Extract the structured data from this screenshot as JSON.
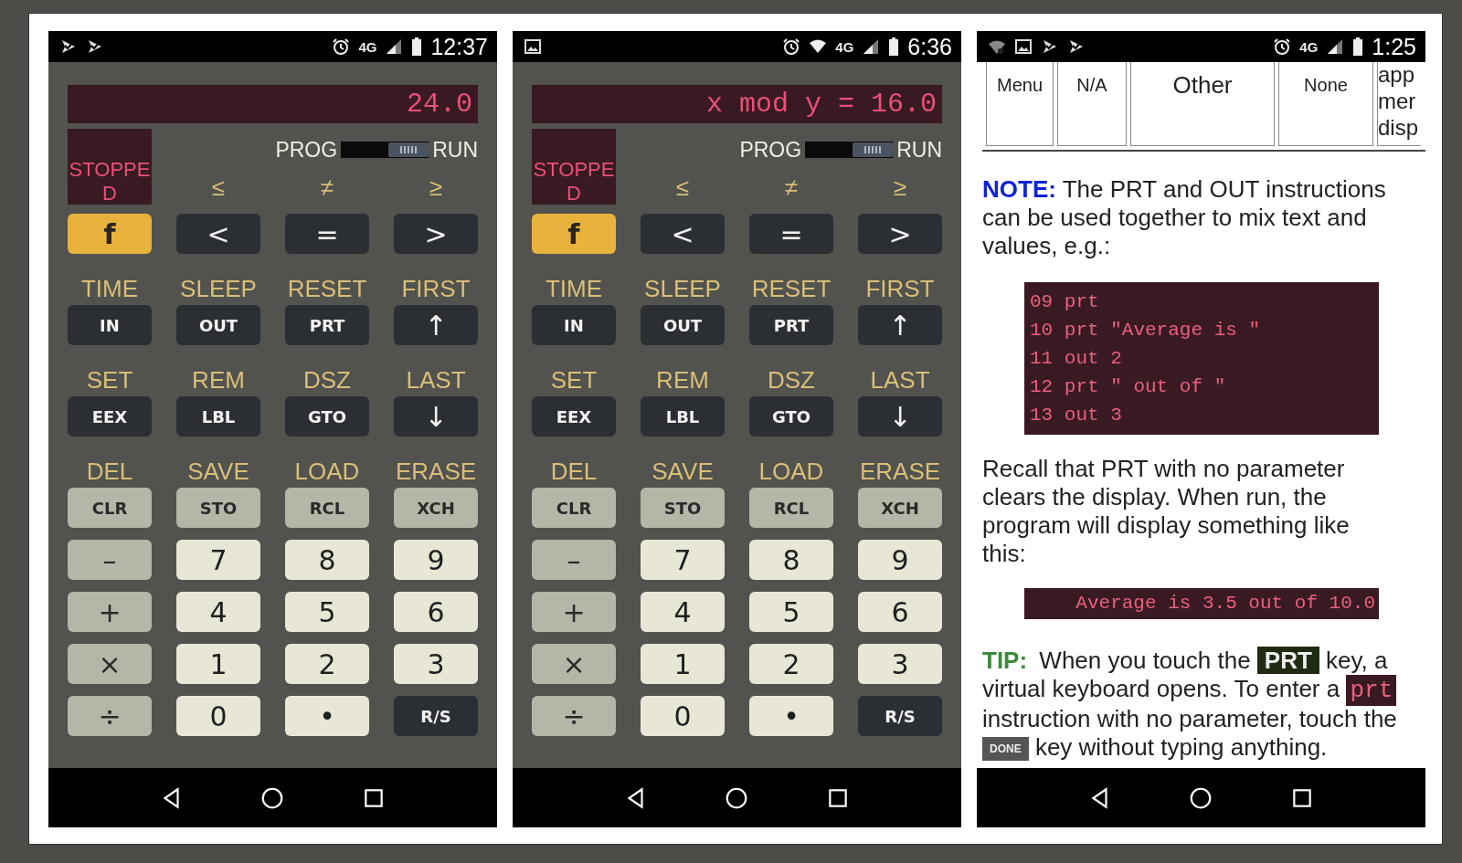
{
  "phones": [
    {
      "kind": "calculator",
      "status_bar": {
        "left_icons": [
          {
            "kind": "flag"
          },
          {
            "kind": "flag"
          }
        ],
        "right_icons": [
          {
            "kind": "alarm"
          },
          {
            "kind": "network",
            "label": "4G"
          },
          {
            "kind": "signal"
          },
          {
            "kind": "battery"
          }
        ],
        "time": "12:37"
      },
      "display": "24.0",
      "status_text": "STOPPED",
      "mode_switch": {
        "left": "PROG",
        "right": "RUN",
        "run": true
      },
      "keypad": [
        {
          "kind": "top",
          "keys": [
            {
              "label": "f",
              "kind": "gold"
            },
            {
              "shift": "≤",
              "label": "<",
              "kind": "dark"
            },
            {
              "shift": "≠",
              "label": "=",
              "kind": "dark"
            },
            {
              "shift": "≥",
              "label": ">",
              "kind": "dark"
            }
          ]
        },
        {
          "kind": "shifted",
          "keys": [
            {
              "shift": "TIME",
              "label": "IN",
              "kind": "dark"
            },
            {
              "shift": "SLEEP",
              "label": "OUT",
              "kind": "dark"
            },
            {
              "shift": "RESET",
              "label": "PRT",
              "kind": "dark"
            },
            {
              "shift": "FIRST",
              "label": "↑",
              "kind": "dark"
            }
          ]
        },
        {
          "kind": "shifted",
          "keys": [
            {
              "shift": "SET",
              "label": "EEX",
              "kind": "dark"
            },
            {
              "shift": "REM",
              "label": "LBL",
              "kind": "dark"
            },
            {
              "shift": "DSZ",
              "label": "GTO",
              "kind": "dark"
            },
            {
              "shift": "LAST",
              "label": "↓",
              "kind": "dark"
            }
          ]
        },
        {
          "kind": "shifted",
          "keys": [
            {
              "shift": "DEL",
              "label": "CLR",
              "kind": "gray"
            },
            {
              "shift": "SAVE",
              "label": "STO",
              "kind": "gray"
            },
            {
              "shift": "LOAD",
              "label": "RCL",
              "kind": "gray"
            },
            {
              "shift": "ERASE",
              "label": "XCH",
              "kind": "gray"
            }
          ]
        },
        {
          "kind": "plain",
          "keys": [
            {
              "label": "–",
              "kind": "gray"
            },
            {
              "label": "7",
              "kind": "cream"
            },
            {
              "label": "8",
              "kind": "cream"
            },
            {
              "label": "9",
              "kind": "cream"
            }
          ]
        },
        {
          "kind": "plain",
          "keys": [
            {
              "label": "+",
              "kind": "gray"
            },
            {
              "label": "4",
              "kind": "cream"
            },
            {
              "label": "5",
              "kind": "cream"
            },
            {
              "label": "6",
              "kind": "cream"
            }
          ]
        },
        {
          "kind": "plain",
          "keys": [
            {
              "label": "×",
              "kind": "gray"
            },
            {
              "label": "1",
              "kind": "cream"
            },
            {
              "label": "2",
              "kind": "cream"
            },
            {
              "label": "3",
              "kind": "cream"
            }
          ]
        },
        {
          "kind": "plain",
          "keys": [
            {
              "label": "÷",
              "kind": "gray"
            },
            {
              "label": "0",
              "kind": "cream"
            },
            {
              "label": "•",
              "kind": "cream"
            },
            {
              "label": "R/S",
              "kind": "dark"
            }
          ]
        }
      ]
    },
    {
      "kind": "calculator",
      "status_bar": {
        "left_icons": [
          {
            "kind": "image"
          }
        ],
        "right_icons": [
          {
            "kind": "alarm"
          },
          {
            "kind": "wifi"
          },
          {
            "kind": "network",
            "label": "4G"
          },
          {
            "kind": "signal"
          },
          {
            "kind": "battery"
          }
        ],
        "time": "6:36"
      },
      "display": "x mod y = 16.0",
      "status_text": "STOPPED",
      "mode_switch": {
        "left": "PROG",
        "right": "RUN",
        "run": true
      },
      "keypad": [
        {
          "kind": "top",
          "keys": [
            {
              "label": "f",
              "kind": "gold"
            },
            {
              "shift": "≤",
              "label": "<",
              "kind": "dark"
            },
            {
              "shift": "≠",
              "label": "=",
              "kind": "dark"
            },
            {
              "shift": "≥",
              "label": ">",
              "kind": "dark"
            }
          ]
        },
        {
          "kind": "shifted",
          "keys": [
            {
              "shift": "TIME",
              "label": "IN",
              "kind": "dark"
            },
            {
              "shift": "SLEEP",
              "label": "OUT",
              "kind": "dark"
            },
            {
              "shift": "RESET",
              "label": "PRT",
              "kind": "dark"
            },
            {
              "shift": "FIRST",
              "label": "↑",
              "kind": "dark"
            }
          ]
        },
        {
          "kind": "shifted",
          "keys": [
            {
              "shift": "SET",
              "label": "EEX",
              "kind": "dark"
            },
            {
              "shift": "REM",
              "label": "LBL",
              "kind": "dark"
            },
            {
              "shift": "DSZ",
              "label": "GTO",
              "kind": "dark"
            },
            {
              "shift": "LAST",
              "label": "↓",
              "kind": "dark"
            }
          ]
        },
        {
          "kind": "shifted",
          "keys": [
            {
              "shift": "DEL",
              "label": "CLR",
              "kind": "gray"
            },
            {
              "shift": "SAVE",
              "label": "STO",
              "kind": "gray"
            },
            {
              "shift": "LOAD",
              "label": "RCL",
              "kind": "gray"
            },
            {
              "shift": "ERASE",
              "label": "XCH",
              "kind": "gray"
            }
          ]
        },
        {
          "kind": "plain",
          "keys": [
            {
              "label": "–",
              "kind": "gray"
            },
            {
              "label": "7",
              "kind": "cream"
            },
            {
              "label": "8",
              "kind": "cream"
            },
            {
              "label": "9",
              "kind": "cream"
            }
          ]
        },
        {
          "kind": "plain",
          "keys": [
            {
              "label": "+",
              "kind": "gray"
            },
            {
              "label": "4",
              "kind": "cream"
            },
            {
              "label": "5",
              "kind": "cream"
            },
            {
              "label": "6",
              "kind": "cream"
            }
          ]
        },
        {
          "kind": "plain",
          "keys": [
            {
              "label": "×",
              "kind": "gray"
            },
            {
              "label": "1",
              "kind": "cream"
            },
            {
              "label": "2",
              "kind": "cream"
            },
            {
              "label": "3",
              "kind": "cream"
            }
          ]
        },
        {
          "kind": "plain",
          "keys": [
            {
              "label": "÷",
              "kind": "gray"
            },
            {
              "label": "0",
              "kind": "cream"
            },
            {
              "label": "•",
              "kind": "cream"
            },
            {
              "label": "R/S",
              "kind": "dark"
            }
          ]
        }
      ]
    },
    {
      "kind": "document",
      "status_bar": {
        "left_icons": [
          {
            "kind": "wifi-question"
          },
          {
            "kind": "image"
          },
          {
            "kind": "flag"
          },
          {
            "kind": "flag"
          }
        ],
        "right_icons": [
          {
            "kind": "alarm"
          },
          {
            "kind": "network",
            "label": "4G"
          },
          {
            "kind": "signal"
          },
          {
            "kind": "battery"
          }
        ],
        "time": "1:25"
      },
      "table_cells": [
        "Menu",
        "N/A",
        "Other",
        "None",
        "app mer disp"
      ],
      "note": "**NOTE:**  The PRT and OUT instructions can be used together to mix text and values, e.g.:",
      "code_lines": [
        "09 prt",
        "10 prt \"Average is \"",
        "11 out 2",
        "12 prt \" out of \"",
        "13 out 3"
      ],
      "recall": "Recall that PRT with no parameter clears the display. When run, the program will display something like this:",
      "output": "Average is 3.5 out of 10.0",
      "tip": [
        {
          "kind": "label",
          "text": "TIP:"
        },
        {
          "kind": "text",
          "text": "When you touch the"
        },
        {
          "kind": "key",
          "text": "PRT"
        },
        {
          "kind": "text",
          "text": "key, a virtual keyboard opens. To enter a"
        },
        {
          "kind": "code",
          "text": "prt"
        },
        {
          "kind": "text",
          "text": "instruction with no parameter, touch the"
        },
        {
          "kind": "button",
          "text": "DONE"
        },
        {
          "kind": "text",
          "text": "key without typing anything."
        }
      ]
    }
  ]
}
